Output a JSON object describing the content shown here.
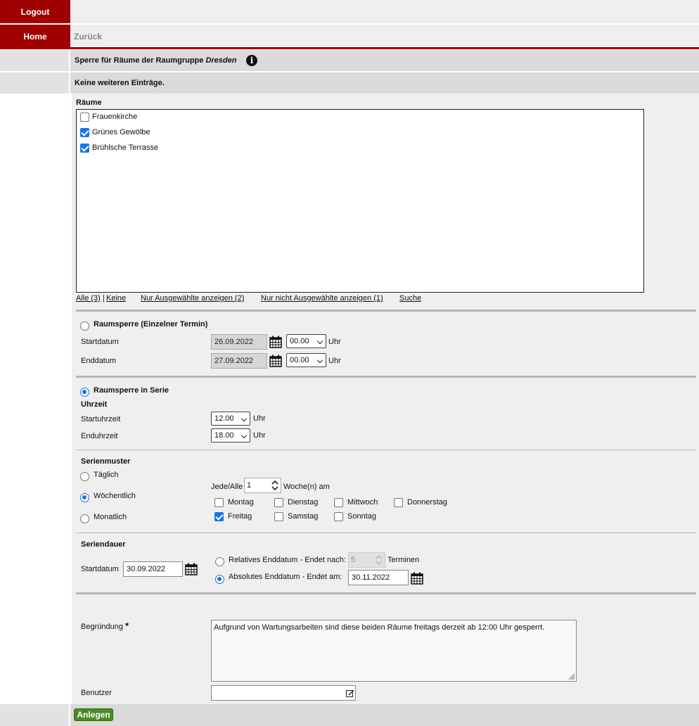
{
  "nav": {
    "logout": "Logout",
    "home": "Home",
    "back": "Zurück"
  },
  "header": {
    "title_prefix": "Sperre für Räume der Raumgruppe",
    "group": "Dresden",
    "info_icon": "info-icon"
  },
  "notice": "Keine weiteren Einträge.",
  "rooms": {
    "label": "Räume",
    "items": [
      {
        "label": "Frauenkirche",
        "checked": false
      },
      {
        "label": "Grünes Gewölbe",
        "checked": true
      },
      {
        "label": "Brühlsche Terrasse",
        "checked": true
      }
    ],
    "links": {
      "all": "Alle (3)",
      "sep": "|",
      "none": "Keine",
      "only_selected": "Nur Ausgewählte anzeigen (2)",
      "only_unselected": "Nur nicht Ausgewählte anzeigen (1)",
      "search": "Suche"
    }
  },
  "single": {
    "title": "Raumsperre (Einzelner Termin)",
    "start_label": "Startdatum",
    "start_date": "26.09.2022",
    "start_time": "00.00",
    "end_label": "Enddatum",
    "end_date": "27.09.2022",
    "end_time": "00.00",
    "unit": "Uhr"
  },
  "series": {
    "title": "Raumsperre in Serie",
    "time_heading": "Uhrzeit",
    "start_time_label": "Startuhrzeit",
    "start_time": "12.00",
    "end_time_label": "Enduhrzeit",
    "end_time": "18.00",
    "unit": "Uhr",
    "pattern_heading": "Serienmuster",
    "daily": "Täglich",
    "weekly": "Wöchentlich",
    "monthly": "Monatlich",
    "every_label": "Jede/Alle",
    "every_value": "1",
    "every_suffix": "Woche(n) am",
    "days": [
      {
        "label": "Montag",
        "checked": false
      },
      {
        "label": "Dienstag",
        "checked": false
      },
      {
        "label": "Mittwoch",
        "checked": false
      },
      {
        "label": "Donnerstag",
        "checked": false
      },
      {
        "label": "Freitag",
        "checked": true
      },
      {
        "label": "Samstag",
        "checked": false
      },
      {
        "label": "Sonntag",
        "checked": false
      }
    ],
    "duration_heading": "Seriendauer",
    "duration_start_label": "Startdatum",
    "duration_start": "30.09.2022",
    "relative_label": "Relatives Enddatum - Endet nach:",
    "relative_value": "5",
    "relative_suffix": "Terminen",
    "absolute_label": "Absolutes Enddatum - Endet am:",
    "absolute_value": "30.11.2022"
  },
  "reason": {
    "label": "Begründung",
    "required": "*",
    "text": "Aufgrund von Wartungsarbeiten sind diese beiden Räume freitags derzeit ab 12:00 Uhr gesperrt."
  },
  "user": {
    "label": "Benutzer",
    "value": ""
  },
  "submit": "Anlegen",
  "colors": {
    "brand": "#a00000",
    "accent": "#1a73e8",
    "submit": "#4a8a2a"
  }
}
